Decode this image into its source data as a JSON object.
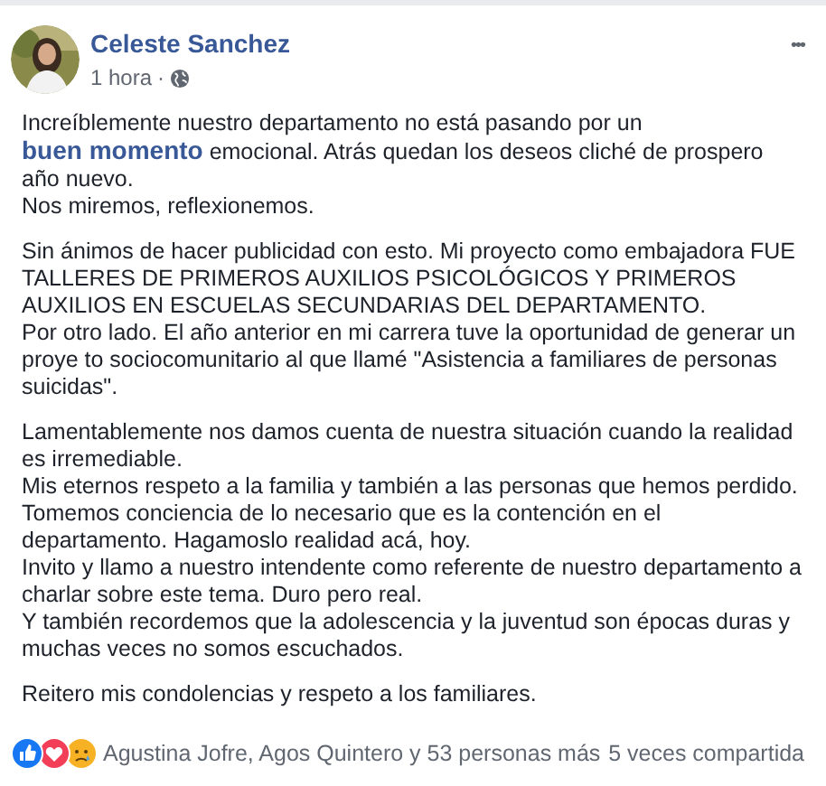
{
  "post": {
    "author": "Celeste Sanchez",
    "time": "1 hora",
    "separator": "·",
    "more": "•••"
  },
  "paragraphs": [
    [
      {
        "text": "Increíblemente nuestro departamento no está pasando por un ",
        "link": "buen momento",
        "after": " emocional. Atrás quedan los deseos cliché de prospero año nuevo."
      },
      {
        "text": "Nos miremos, reflexionemos."
      }
    ],
    [
      {
        "text": "Sin ánimos de hacer publicidad con esto. Mi proyecto como embajadora FUE TALLERES DE PRIMEROS AUXILIOS PSICOLÓGICOS Y PRIMEROS AUXILIOS EN ESCUELAS SECUNDARIAS DEL DEPARTAMENTO."
      },
      {
        "text": "Por otro lado. El año anterior en mi carrera tuve la oportunidad de generar un proye to sociocomunitario al que llamé \"Asistencia a familiares de personas suicidas\"."
      }
    ],
    [
      {
        "text": "Lamentablemente nos damos cuenta de nuestra situación cuando la realidad es irremediable."
      },
      {
        "text": "Mis eternos respeto a la familia y también a las personas que hemos perdido."
      },
      {
        "text": "Tomemos conciencia de lo necesario que es la contención en el departamento. Hagamoslo realidad acá, hoy."
      },
      {
        "text": "Invito y llamo a nuestro intendente como referente de nuestro departamento a charlar sobre este tema. Duro pero real."
      },
      {
        "text": "Y también recordemos que la adolescencia y la juventud son épocas duras y muchas veces no somos escuchados."
      }
    ],
    [
      {
        "text": "Reitero mis condolencias y respeto a los familiares."
      }
    ]
  ],
  "footer": {
    "reactions": [
      {
        "kind": "like"
      },
      {
        "kind": "love"
      },
      {
        "kind": "sad"
      }
    ],
    "names": "Agustina Jofre, Agos Quintero y 53 personas más",
    "shares": "5 veces compartida"
  }
}
